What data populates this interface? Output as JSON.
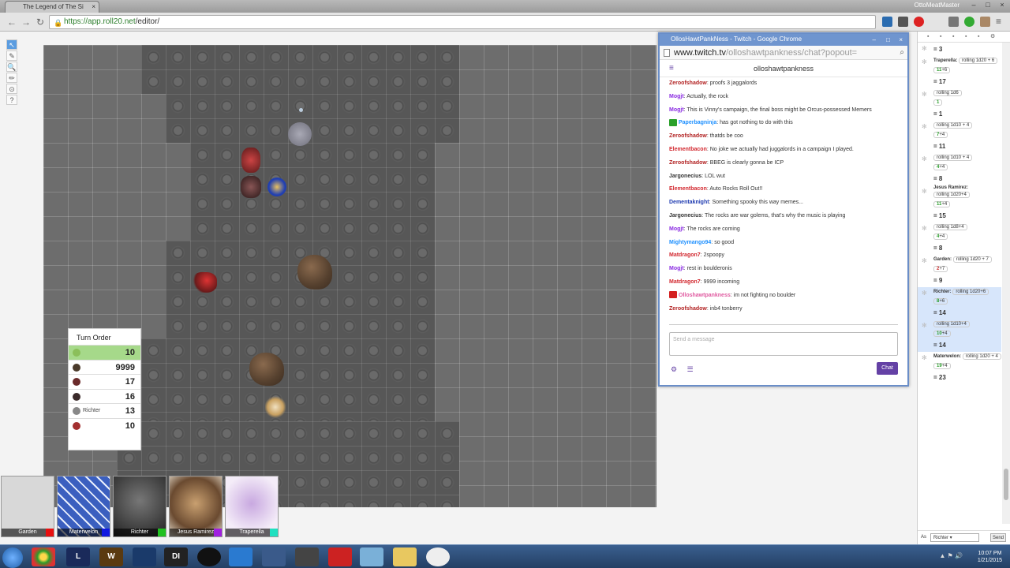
{
  "browser": {
    "tab_title": "The Legend of The Si",
    "tab_close": "×",
    "user": "OttoMeatMaster",
    "url_host": "https://app.roll20.net",
    "url_path": "/editor/",
    "window_buttons": [
      "–",
      "□",
      "×"
    ]
  },
  "editor": {
    "tools": [
      "↖",
      "✎",
      "🔍",
      "✏",
      "⊙",
      "?"
    ]
  },
  "turn_order": {
    "title": "Turn Order",
    "entries": [
      {
        "name": "",
        "value": "10",
        "color": "#8bbf5a",
        "active": true
      },
      {
        "name": "",
        "value": "9999",
        "color": "#4a3a2a",
        "active": false
      },
      {
        "name": "",
        "value": "17",
        "color": "#6a2a2a",
        "active": false
      },
      {
        "name": "",
        "value": "16",
        "color": "#3a2a2a",
        "active": false
      },
      {
        "name": "Richter",
        "value": "13",
        "color": "#888888",
        "active": false
      },
      {
        "name": "",
        "value": "10",
        "color": "#a33030",
        "active": false
      }
    ]
  },
  "players": [
    {
      "name": "Garden",
      "swatch": "#e81010",
      "bg": "#d8d8d8"
    },
    {
      "name": "Materwelon",
      "swatch": "#1018e0",
      "bg": "#3b5fbf"
    },
    {
      "name": "Richter",
      "swatch": "#20c020",
      "bg": "#3a3a3a"
    },
    {
      "name": "Jesus Ramirez",
      "swatch": "#a020e0",
      "bg": "#8a7050"
    },
    {
      "name": "Traperella",
      "swatch": "#20e0c0",
      "bg": "#e8d8f0"
    }
  ],
  "twitch": {
    "window_title": "OllosHawtPankNess - Twitch - Google Chrome",
    "url_host": "www.twitch.tv",
    "url_path": "/olloshawtpankness/chat?popout=",
    "channel": "olloshawtpankness",
    "placeholder": "Send a message",
    "chat_button": "Chat",
    "messages": [
      {
        "user": "Zeroofshadow",
        "color": "#b22222",
        "text": "proofs 3 jaggalords",
        "badge": ""
      },
      {
        "user": "Mogjt",
        "color": "#8a2be2",
        "text": "Actually, the rock",
        "badge": ""
      },
      {
        "user": "Mogjt",
        "color": "#8a2be2",
        "text": "This is Vinny's campaign, the final boss might be Orcus-possessed Memers",
        "badge": ""
      },
      {
        "user": "Paperbagninja",
        "color": "#1e90ff",
        "text": "has got nothing to do with this",
        "badge": "#2aa02a"
      },
      {
        "user": "Zeroofshadow",
        "color": "#b22222",
        "text": "thatds be coo",
        "badge": ""
      },
      {
        "user": "Elementbacon",
        "color": "#d2282f",
        "text": "No joke we actually had juggalords in a campaign I played.",
        "badge": ""
      },
      {
        "user": "Zeroofshadow",
        "color": "#b22222",
        "text": "BBEG is clearly gonna be ICP",
        "badge": ""
      },
      {
        "user": "Jargonecius",
        "color": "#333333",
        "text": "LOL wut",
        "badge": ""
      },
      {
        "user": "Elementbacon",
        "color": "#d2282f",
        "text": "Auto Rocks Roll Out!!",
        "badge": ""
      },
      {
        "user": "Dementaknight",
        "color": "#1e3ab0",
        "text": "Something spooky this way memes...",
        "badge": ""
      },
      {
        "user": "Jargonecius",
        "color": "#333333",
        "text": "The rocks are war golems, that's why the music is playing",
        "badge": ""
      },
      {
        "user": "Mogjt",
        "color": "#8a2be2",
        "text": "The rocks are coming",
        "badge": ""
      },
      {
        "user": "Mightymango94",
        "color": "#1e90ff",
        "text": "so good",
        "badge": ""
      },
      {
        "user": "Matdragon7",
        "color": "#d2282f",
        "text": "2spoopy",
        "badge": ""
      },
      {
        "user": "Mogjt",
        "color": "#8a2be2",
        "text": "rest in boulderonis",
        "badge": ""
      },
      {
        "user": "Matdragon7",
        "color": "#d2282f",
        "text": "9999 incoming",
        "badge": ""
      },
      {
        "user": "Olloshawtpankness",
        "color": "#e05aa0",
        "text": "im not fighting no boulder",
        "badge": "#d42020"
      },
      {
        "user": "Zeroofshadow",
        "color": "#b22222",
        "text": "inb4 tonberry",
        "badge": ""
      }
    ]
  },
  "sidebar": {
    "as_label": "As",
    "as_value": "Richter",
    "send_label": "Send",
    "rolls": [
      {
        "who": "",
        "formula": "",
        "dice": "",
        "result": "3",
        "hl": false
      },
      {
        "who": "Traperella:",
        "formula": "rolling 1d20 + 6",
        "dice": "11",
        "mod": "+6",
        "result": "17",
        "hl": false
      },
      {
        "who": "",
        "formula": "rolling 1d6",
        "dice": "1",
        "mod": "",
        "result": "1",
        "hl": false
      },
      {
        "who": "",
        "formula": "rolling 1d10 + 4",
        "dice": "7",
        "mod": "+4",
        "result": "11",
        "hl": false
      },
      {
        "who": "",
        "formula": "rolling 1d10 + 4",
        "dice": "4",
        "mod": "+4",
        "result": "8",
        "hl": false
      },
      {
        "who": "Jesus Ramirez:",
        "formula": "rolling 1d20+4",
        "dice": "11",
        "mod": "+4",
        "result": "15",
        "hl": false
      },
      {
        "who": "",
        "formula": "rolling 1d8+4",
        "dice": "4",
        "mod": "+4",
        "result": "8",
        "hl": false
      },
      {
        "who": "Garden:",
        "formula": "rolling 1d20 + 7",
        "dice": "2",
        "mod": "+7",
        "result": "9",
        "hl": false,
        "red": true
      },
      {
        "who": "Richter:",
        "formula": "rolling 1d20+6",
        "dice": "8",
        "mod": "+6",
        "result": "14",
        "hl": true
      },
      {
        "who": "",
        "formula": "rolling 1d10+4",
        "dice": "10",
        "mod": "+4",
        "result": "14",
        "hl": true
      },
      {
        "who": "Materwelon:",
        "formula": "rolling 1d20 + 4",
        "dice": "19",
        "mod": "+4",
        "result": "23",
        "hl": false
      }
    ]
  },
  "taskbar": {
    "apps": [
      "",
      "L",
      "W",
      "",
      "DI",
      "",
      "",
      "",
      "",
      "",
      "",
      "",
      ""
    ],
    "time": "10:07 PM",
    "date": "1/21/2015"
  }
}
